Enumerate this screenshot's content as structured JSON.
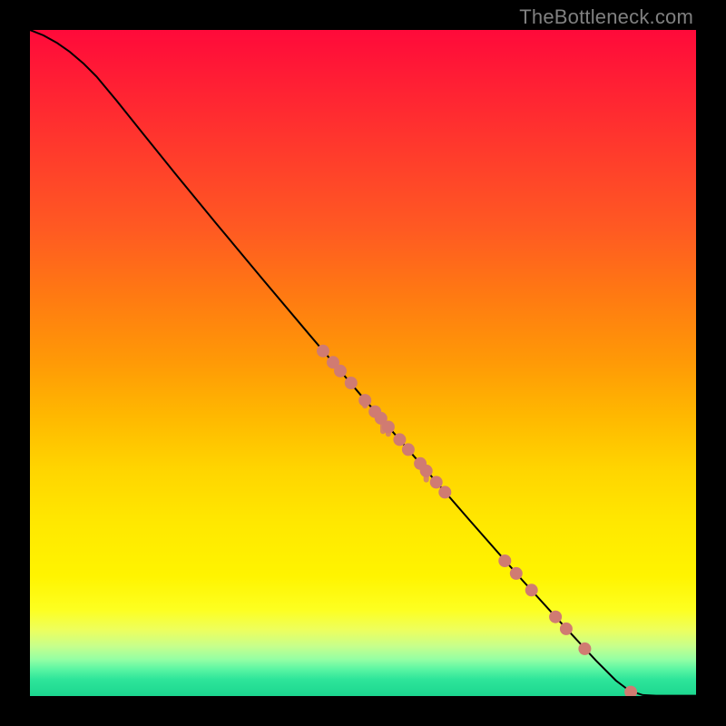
{
  "watermark": "TheBottleneck.com",
  "chart_data": {
    "type": "line",
    "title": "",
    "xlabel": "",
    "ylabel": "",
    "xlim": [
      0,
      100
    ],
    "ylim": [
      0,
      100
    ],
    "grid": false,
    "legend": false,
    "curve": [
      {
        "x": 0.0,
        "y": 100.0
      },
      {
        "x": 2.0,
        "y": 99.2
      },
      {
        "x": 4.0,
        "y": 98.1
      },
      {
        "x": 6.0,
        "y": 96.7
      },
      {
        "x": 8.0,
        "y": 95.0
      },
      {
        "x": 10.0,
        "y": 93.0
      },
      {
        "x": 13.0,
        "y": 89.4
      },
      {
        "x": 17.0,
        "y": 84.4
      },
      {
        "x": 22.0,
        "y": 78.2
      },
      {
        "x": 28.0,
        "y": 70.9
      },
      {
        "x": 35.0,
        "y": 62.5
      },
      {
        "x": 42.0,
        "y": 54.2
      },
      {
        "x": 50.0,
        "y": 44.8
      },
      {
        "x": 58.0,
        "y": 35.6
      },
      {
        "x": 66.0,
        "y": 26.4
      },
      {
        "x": 74.0,
        "y": 17.3
      },
      {
        "x": 80.0,
        "y": 10.7
      },
      {
        "x": 85.0,
        "y": 5.3
      },
      {
        "x": 88.0,
        "y": 2.3
      },
      {
        "x": 90.0,
        "y": 0.8
      },
      {
        "x": 92.0,
        "y": 0.15
      },
      {
        "x": 94.0,
        "y": 0.05
      },
      {
        "x": 100.0,
        "y": 0.05
      }
    ],
    "markers": [
      {
        "x": 44.0,
        "y": 51.8
      },
      {
        "x": 45.5,
        "y": 50.1
      },
      {
        "x": 46.6,
        "y": 48.8
      },
      {
        "x": 48.2,
        "y": 47.0
      },
      {
        "x": 50.3,
        "y": 44.4
      },
      {
        "x": 51.8,
        "y": 42.7
      },
      {
        "x": 52.7,
        "y": 41.7
      },
      {
        "x": 53.8,
        "y": 40.4
      },
      {
        "x": 55.5,
        "y": 38.5
      },
      {
        "x": 56.8,
        "y": 37.0
      },
      {
        "x": 58.6,
        "y": 34.9
      },
      {
        "x": 59.5,
        "y": 33.8
      },
      {
        "x": 61.0,
        "y": 32.1
      },
      {
        "x": 62.3,
        "y": 30.6
      },
      {
        "x": 71.3,
        "y": 20.3
      },
      {
        "x": 73.0,
        "y": 18.4
      },
      {
        "x": 75.3,
        "y": 15.9
      },
      {
        "x": 78.9,
        "y": 11.9
      },
      {
        "x": 80.5,
        "y": 10.1
      },
      {
        "x": 83.3,
        "y": 7.1
      },
      {
        "x": 90.2,
        "y": 0.6
      }
    ],
    "marker_drips": [
      {
        "x": 50.3,
        "dy": 1.3
      },
      {
        "x": 53.0,
        "dy": 2.0
      },
      {
        "x": 53.8,
        "dy": 1.5
      },
      {
        "x": 59.5,
        "dy": 1.8
      }
    ],
    "overall_marker_color": "#d07b72",
    "curve_color": "#000000"
  }
}
